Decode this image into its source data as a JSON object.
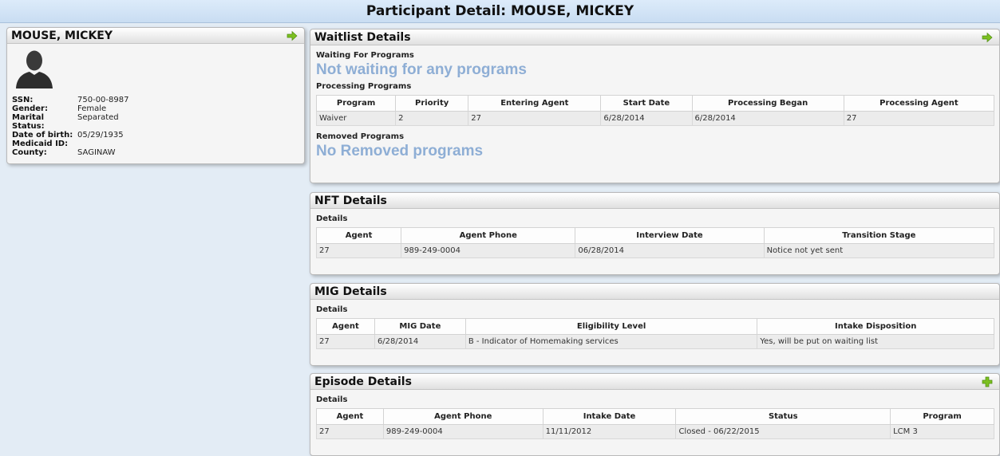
{
  "page_title": "Participant Detail: MOUSE, MICKEY",
  "profile": {
    "name": "MOUSE, MICKEY",
    "fields": [
      {
        "label": "SSN:",
        "value": "750-00-8987"
      },
      {
        "label": "Gender:",
        "value": "Female"
      },
      {
        "label": "Marital Status:",
        "value": "Separated"
      },
      {
        "label": "Date of birth:",
        "value": "05/29/1935"
      },
      {
        "label": "Medicaid ID:",
        "value": ""
      },
      {
        "label": "County:",
        "value": "SAGINAW"
      }
    ]
  },
  "waitlist": {
    "title": "Waitlist Details",
    "waiting_label": "Waiting For Programs",
    "waiting_empty": "Not waiting for any programs",
    "processing_label": "Processing Programs",
    "processing_headers": [
      "Program",
      "Priority",
      "Entering Agent",
      "Start Date",
      "Processing Began",
      "Processing Agent"
    ],
    "processing_rows": [
      [
        "Waiver",
        "2",
        "27",
        "6/28/2014",
        "6/28/2014",
        "27"
      ]
    ],
    "removed_label": "Removed Programs",
    "removed_empty": "No Removed programs"
  },
  "nft": {
    "title": "NFT Details",
    "details_label": "Details",
    "headers": [
      "Agent",
      "Agent Phone",
      "Interview Date",
      "Transition Stage"
    ],
    "rows": [
      [
        "27",
        "989-249-0004",
        "06/28/2014",
        "Notice not yet sent"
      ]
    ]
  },
  "mig": {
    "title": "MIG Details",
    "details_label": "Details",
    "headers": [
      "Agent",
      "MIG Date",
      "Eligibility Level",
      "Intake Disposition"
    ],
    "rows": [
      [
        "27",
        "6/28/2014",
        "B - Indicator of Homemaking services",
        "Yes, will be put on waiting list"
      ]
    ]
  },
  "episode": {
    "title": "Episode Details",
    "details_label": "Details",
    "headers": [
      "Agent",
      "Agent Phone",
      "Intake Date",
      "Status",
      "Program"
    ],
    "rows": [
      [
        "27",
        "989-249-0004",
        "11/11/2012",
        "Closed - 06/22/2015",
        "LCM 3"
      ]
    ]
  },
  "icons": {
    "arrow": "arrow-right-icon",
    "add": "plus-icon",
    "avatar": "person-silhouette-icon"
  },
  "colors": {
    "icon_green": "#7cc020",
    "empty_text": "#8eaed5",
    "header_bg": "#c9ddf2"
  }
}
